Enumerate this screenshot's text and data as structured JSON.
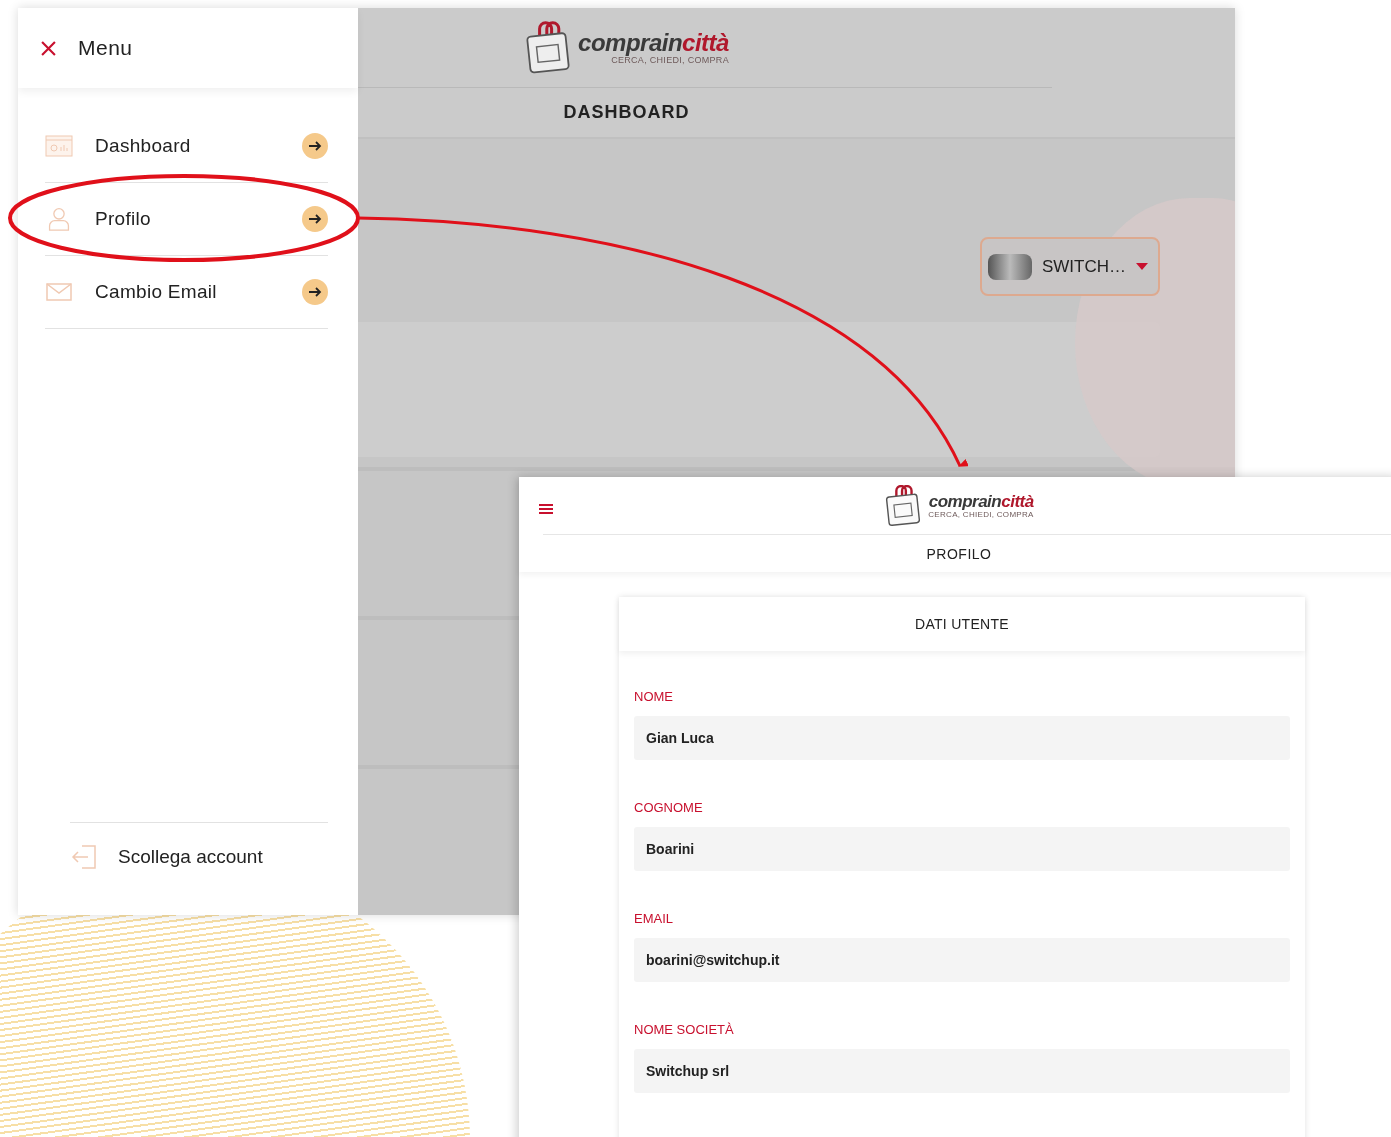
{
  "dashboard_window": {
    "header": {
      "logo": {
        "brand_dark": "comprain",
        "brand_red": "città",
        "tagline": "CERCA, CHIEDI, COMPRA"
      },
      "page_title": "DASHBOARD"
    },
    "switcher": {
      "label": "SWITCH…"
    },
    "menu": {
      "title": "Menu",
      "items": [
        {
          "kind": "dashboard",
          "label": "Dashboard"
        },
        {
          "kind": "user",
          "label": "Profilo"
        },
        {
          "kind": "mail",
          "label": "Cambio Email"
        }
      ],
      "logout": "Scollega account"
    }
  },
  "profile_window": {
    "header": {
      "logo": {
        "brand_dark": "comprain",
        "brand_red": "città",
        "tagline": "CERCA, CHIEDI, COMPRA"
      },
      "page_title": "PROFILO"
    },
    "card_title": "DATI UTENTE",
    "fields": [
      {
        "label": "NOME",
        "value": "Gian Luca"
      },
      {
        "label": "COGNOME",
        "value": "Boarini"
      },
      {
        "label": "EMAIL",
        "value": "boarini@switchup.it"
      },
      {
        "label": "NOME SOCIETÀ",
        "value": "Switchup srl"
      }
    ]
  }
}
